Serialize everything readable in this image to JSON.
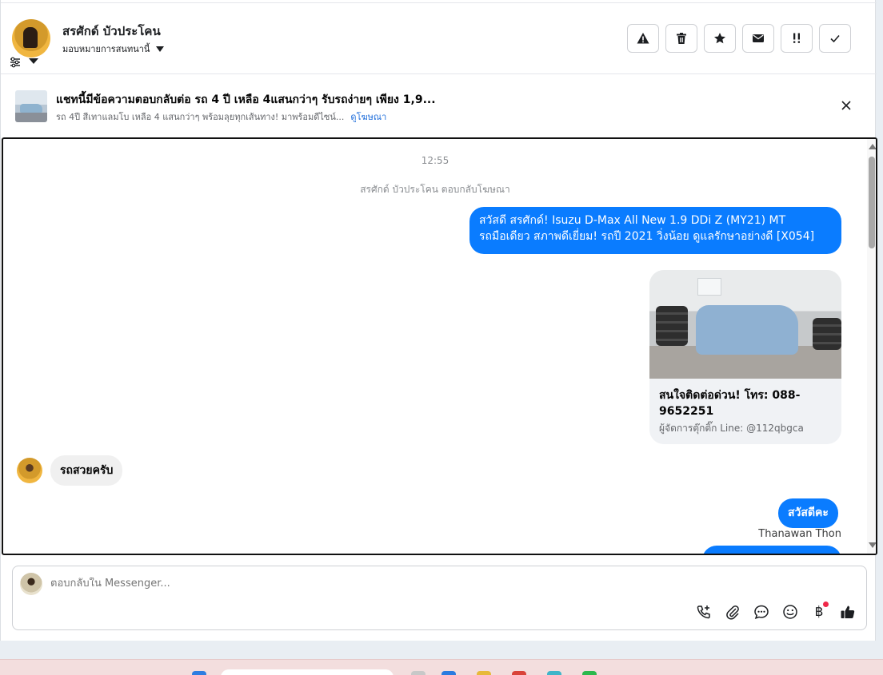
{
  "header": {
    "contact_name": "สรศักด์ บัวประโคน",
    "assign_label": "มอบหมายการสนทนานี้",
    "actions": [
      "spam-icon",
      "trash-icon",
      "star-icon",
      "mail-icon",
      "follow-up-icon",
      "check-icon"
    ]
  },
  "ad": {
    "title": "แชทนี้มีข้อความตอบกลับต่อ รถ 4 ปี เหลือ 4แสนกว่าๆ รับรถง่ายๆ เพียง 1,9...",
    "subtitle": "รถ 4ปี สีเทาแลมโบ เหลือ 4 แสนกว่าๆ พร้อมลุยทุกเส้นทาง! มาพร้อมดีไซน์...",
    "link": "ดูโฆษณา"
  },
  "chat": {
    "time": "12:55",
    "reply_note": "สรศักด์ บัวประโคน ตอบกลับโฆษณา",
    "msg1_line1": "สวัสดี สรศักด์! Isuzu D-Max All New 1.9 DDi Z (MY21) MT",
    "msg1_line2": "รถมือเดียว สภาพดีเยี่ยม! รถปี 2021 วิ่งน้อย ดูแลรักษาอย่างดี [X054]",
    "card_title": "สนใจติดต่อด่วน! โทร: 088-9652251",
    "card_subtitle": "ผู้จัดการตุ๊กติ๊ก Line: @112qbgca",
    "incoming_msg": "รถสวยครับ",
    "msg3": "สวัสดีคะ",
    "sender_name": "Thanawan Thon"
  },
  "composer": {
    "placeholder": "ตอบกลับใน Messenger...",
    "tools": [
      "call-plus-icon",
      "attach-icon",
      "saved-reply-icon",
      "emoji-icon",
      "baht-icon",
      "like-icon"
    ]
  },
  "colors": {
    "accent": "#0a7cff",
    "link": "#216fdb",
    "notify": "#f02849"
  }
}
